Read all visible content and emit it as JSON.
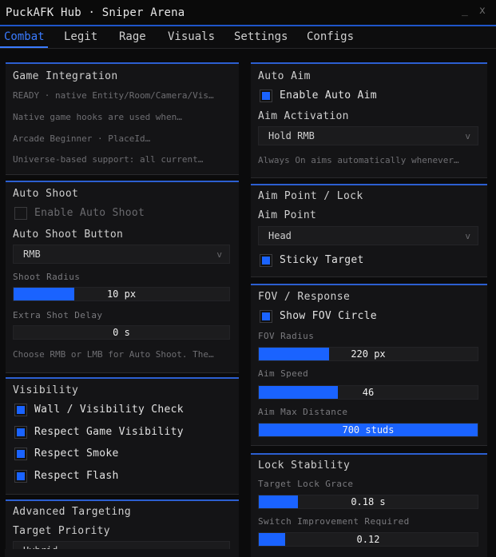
{
  "window": {
    "title": "PuckAFK Hub · Sniper Arena",
    "minimize_glyph": "_",
    "close_glyph": "x"
  },
  "tabs": [
    {
      "label": "Combat",
      "active": true
    },
    {
      "label": "Legit",
      "active": false
    },
    {
      "label": "Rage",
      "active": false
    },
    {
      "label": "Visuals",
      "active": false
    },
    {
      "label": "Settings",
      "active": false
    },
    {
      "label": "Configs",
      "active": false
    }
  ],
  "colors": {
    "accent": "#1a63ff",
    "panel_border": "#2c5fd1",
    "background": "#0b0b0c"
  },
  "left": {
    "game_integration": {
      "title": "Game Integration",
      "lines": [
        "READY · native Entity/Room/Camera/Vis…",
        "Native game hooks are used when…",
        "Arcade Beginner · PlaceId…",
        "Universe-based support: all current…"
      ]
    },
    "auto_shoot": {
      "title": "Auto Shoot",
      "enable": {
        "label": "Enable Auto Shoot",
        "checked": false
      },
      "button_label": "Auto Shoot Button",
      "button_value": "RMB",
      "caret": "v",
      "radius": {
        "label": "Shoot Radius",
        "value": "10 px",
        "fraction": 0.28
      },
      "delay": {
        "label": "Extra Shot Delay",
        "value": "0 s",
        "fraction": 0
      },
      "hint": "Choose RMB or LMB for Auto Shoot. The…"
    },
    "visibility": {
      "title": "Visibility",
      "checks": [
        {
          "label": "Wall / Visibility Check",
          "checked": true
        },
        {
          "label": "Respect Game Visibility",
          "checked": true
        },
        {
          "label": "Respect Smoke",
          "checked": true
        },
        {
          "label": "Respect Flash",
          "checked": true
        }
      ]
    },
    "advanced": {
      "title": "Advanced Targeting",
      "priority_label": "Target Priority",
      "priority_value": "Hybrid"
    }
  },
  "right": {
    "auto_aim": {
      "title": "Auto Aim",
      "enable": {
        "label": "Enable Auto Aim",
        "checked": true
      },
      "activation_label": "Aim Activation",
      "activation_value": "Hold RMB",
      "caret": "v",
      "hint": "Always On aims automatically whenever…"
    },
    "aim_point": {
      "title": "Aim Point / Lock",
      "point_label": "Aim Point",
      "point_value": "Head",
      "caret": "v",
      "sticky": {
        "label": "Sticky Target",
        "checked": true
      }
    },
    "fov": {
      "title": "FOV / Response",
      "show": {
        "label": "Show FOV Circle",
        "checked": true
      },
      "radius": {
        "label": "FOV Radius",
        "value": "220 px",
        "fraction": 0.32
      },
      "speed": {
        "label": "Aim Speed",
        "value": "46",
        "fraction": 0.36
      },
      "distance": {
        "label": "Aim Max Distance",
        "value": "700 studs",
        "fraction": 1.0
      }
    },
    "lock": {
      "title": "Lock Stability",
      "grace": {
        "label": "Target Lock Grace",
        "value": "0.18 s",
        "fraction": 0.18
      },
      "switch": {
        "label": "Switch Improvement Required",
        "value": "0.12",
        "fraction": 0.12
      }
    }
  }
}
